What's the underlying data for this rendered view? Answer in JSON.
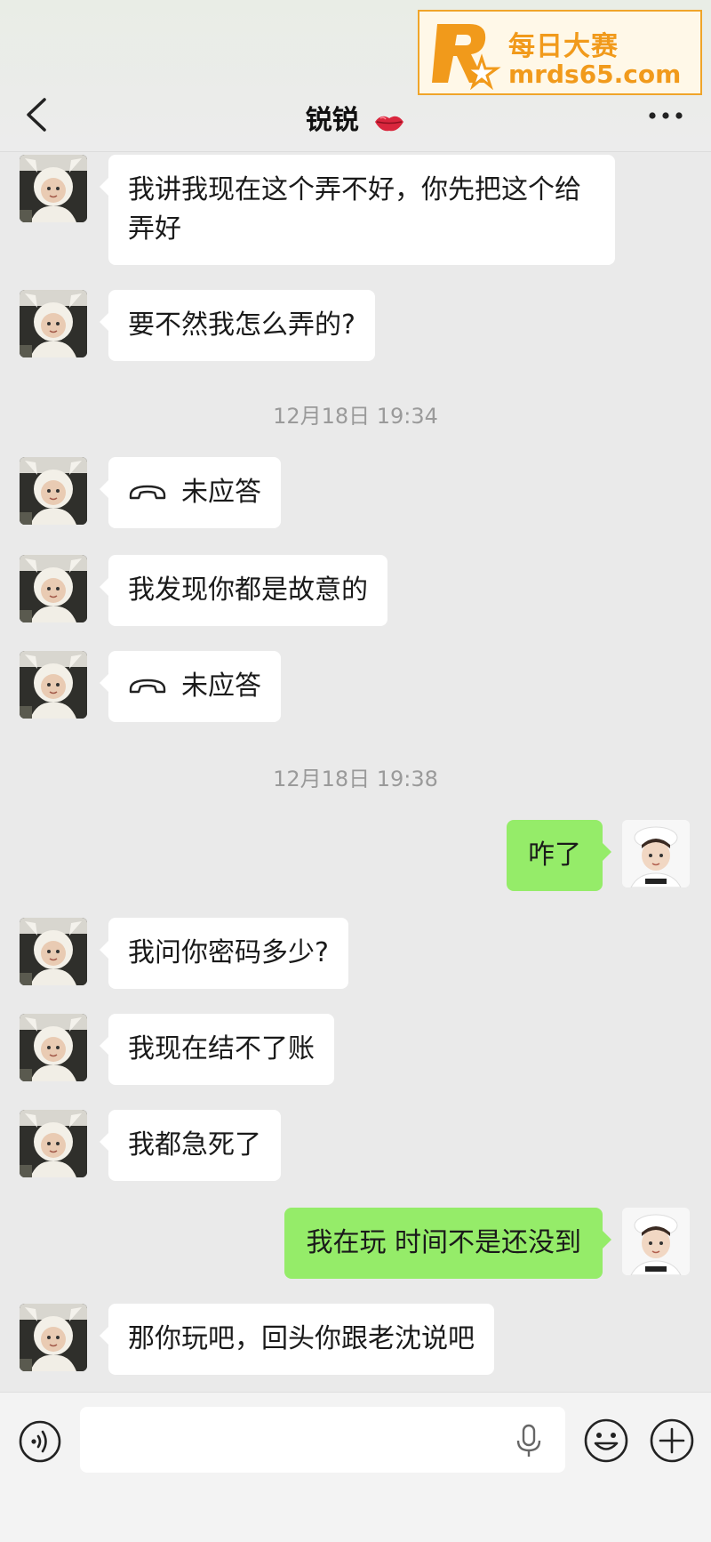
{
  "header": {
    "contact_name": "锐锐",
    "name_emoji_icon": "lips-icon",
    "back_icon": "chevron-left-icon",
    "more_icon": "more-dots-icon"
  },
  "watermark": {
    "line1": "每日大赛",
    "line2": "mrds65.com",
    "color": "#f19a1b"
  },
  "messages": [
    {
      "side": "left",
      "type": "text",
      "text": "我讲我现在这个弄不好，你先把这个给弄好"
    },
    {
      "side": "left",
      "type": "text",
      "text": "要不然我怎么弄的?"
    },
    {
      "type": "timestamp",
      "text": "12月18日 19:34"
    },
    {
      "side": "left",
      "type": "call",
      "text": "未应答"
    },
    {
      "side": "left",
      "type": "text",
      "text": "我发现你都是故意的"
    },
    {
      "side": "left",
      "type": "call",
      "text": "未应答"
    },
    {
      "type": "timestamp",
      "text": "12月18日 19:38"
    },
    {
      "side": "right",
      "type": "text",
      "text": "咋了"
    },
    {
      "side": "left",
      "type": "text",
      "text": "我问你密码多少?"
    },
    {
      "side": "left",
      "type": "text",
      "text": "我现在结不了账"
    },
    {
      "side": "left",
      "type": "text",
      "text": "我都急死了"
    },
    {
      "side": "right",
      "type": "text",
      "text": "我在玩 时间不是还没到"
    },
    {
      "side": "left",
      "type": "text",
      "text": "那你玩吧，回头你跟老沈说吧"
    }
  ],
  "input_bar": {
    "value": "",
    "voice_icon": "voice-icon",
    "mic_icon": "microphone-icon",
    "emoji_icon": "emoji-icon",
    "plus_icon": "plus-icon"
  },
  "colors": {
    "background": "#eaeaea",
    "bubble_left": "#ffffff",
    "bubble_right": "#95ec69",
    "timestamp": "#9a9a9a"
  }
}
